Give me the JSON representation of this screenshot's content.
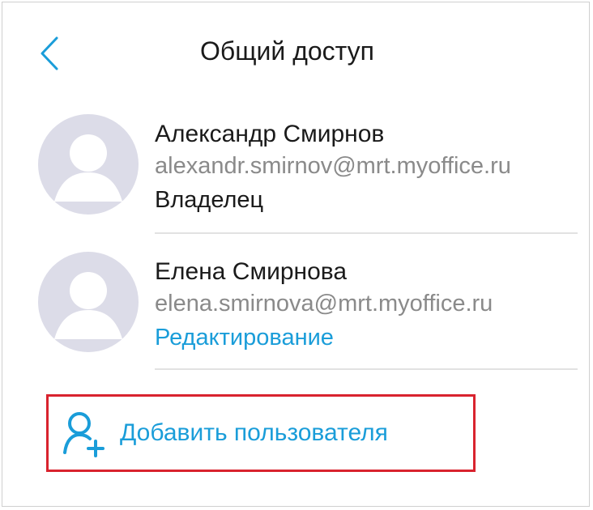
{
  "header": {
    "title": "Общий доступ"
  },
  "users": [
    {
      "name": "Александр Смирнов",
      "email": "alexandr.smirnov@mrt.myoffice.ru",
      "role": "Владелец"
    },
    {
      "name": "Елена Смирнова",
      "email": "elena.smirnova@mrt.myoffice.ru",
      "role": "Редактирование"
    }
  ],
  "actions": {
    "add_user_label": "Добавить пользователя"
  },
  "colors": {
    "accent": "#1a9dd9",
    "highlight_border": "#d9232e",
    "avatar_bg": "#dcdce8"
  },
  "icons": {
    "back": "chevron-left-icon",
    "avatar": "user-placeholder-icon",
    "add_user": "add-user-icon"
  }
}
